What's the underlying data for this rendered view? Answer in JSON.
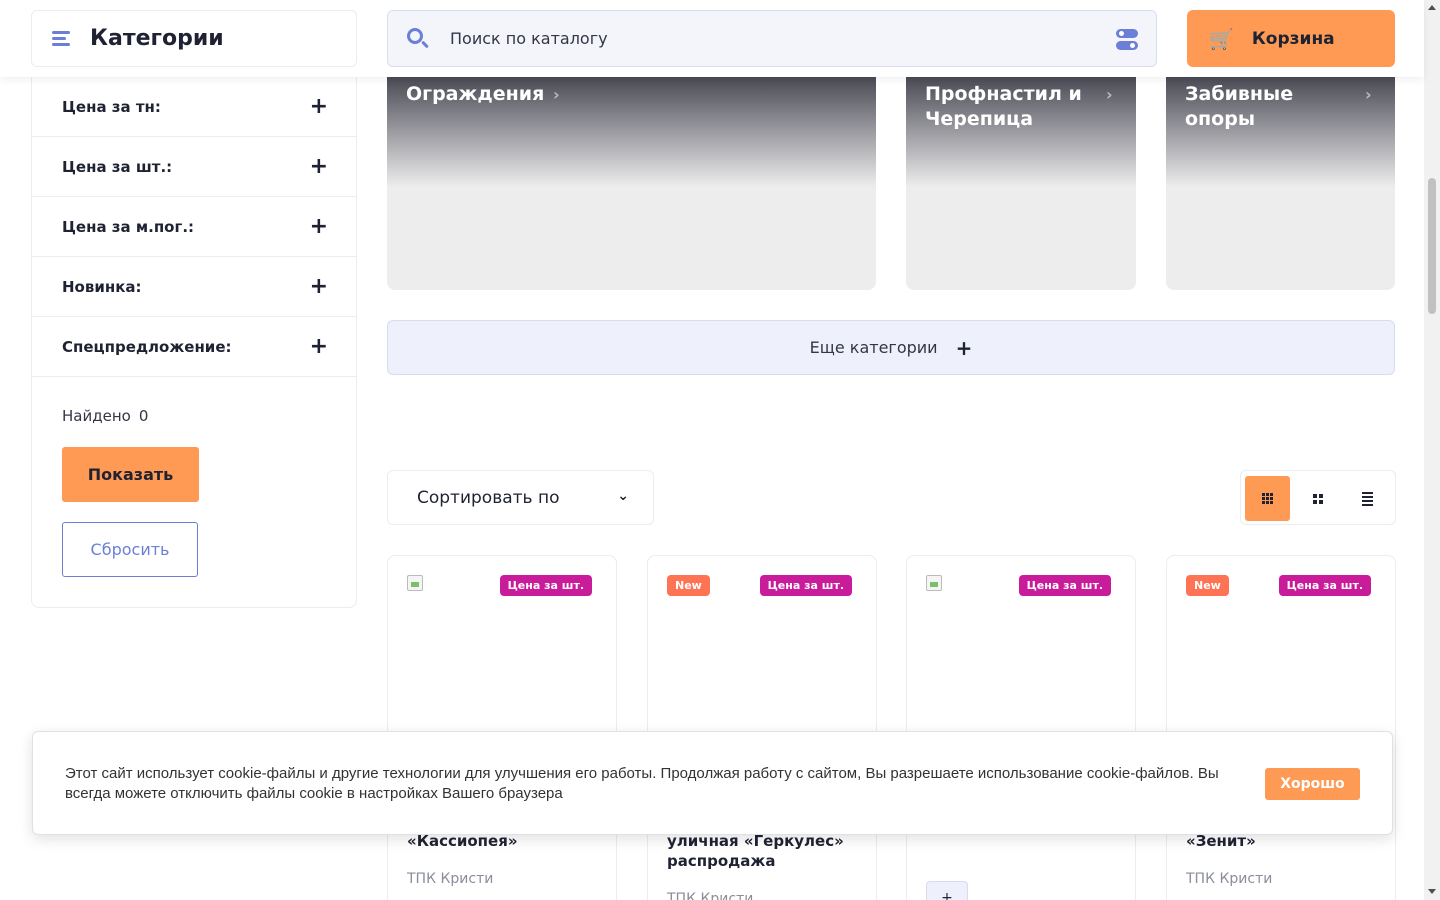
{
  "header": {
    "categories_label": "Категории",
    "search_placeholder": "Поиск по каталогу",
    "cart_label": "Корзина"
  },
  "sidebar": {
    "filters": [
      {
        "label": "Цена за тн:"
      },
      {
        "label": "Цена за шт.:"
      },
      {
        "label": "Цена за м.пог.:"
      },
      {
        "label": "Новинка:"
      },
      {
        "label": "Спецпредложение:"
      }
    ],
    "found_label": "Найдено",
    "found_count": "0",
    "show_button": "Показать",
    "reset_button": "Сбросить"
  },
  "categories": {
    "tiles": [
      {
        "title": "Ограждения"
      },
      {
        "title": "Профнастил и Черепица"
      },
      {
        "title": "Забивные опоры"
      }
    ],
    "more_label": "Еще категории"
  },
  "toolbar": {
    "sort_label": "Сортировать по"
  },
  "products": [
    {
      "badges": [
        "Цена за шт."
      ],
      "name": "«Кассиопея»",
      "brand": "ТПК Кристи"
    },
    {
      "badges": [
        "New",
        "Цена за шт."
      ],
      "name": "уличная «Геркулес» распродажа",
      "brand": "ТПК Кристи"
    },
    {
      "badges": [
        "Цена за шт."
      ],
      "name": "",
      "brand": ""
    },
    {
      "badges": [
        "New",
        "Цена за шт."
      ],
      "name": "«Зенит»",
      "brand": "ТПК Кристи"
    }
  ],
  "cookie": {
    "text": "Этот сайт использует cookie-файлы и другие технологии для улучшения его работы. Продолжая работу с сайтом, Вы разрешаете использование cookie-файлов. Вы всегда можете отключить файлы cookie в настройках Вашего браузера",
    "ok_button": "Хорошо"
  },
  "colors": {
    "accent": "#ff9a55",
    "brand_blue": "#6b7fd7",
    "price_badge": "#c81c9a",
    "new_badge": "#ff7355"
  },
  "icons": {
    "menu": "burger-icon",
    "search": "search-icon",
    "filter_toggle": "toggle-icon",
    "cart": "cart-icon"
  }
}
